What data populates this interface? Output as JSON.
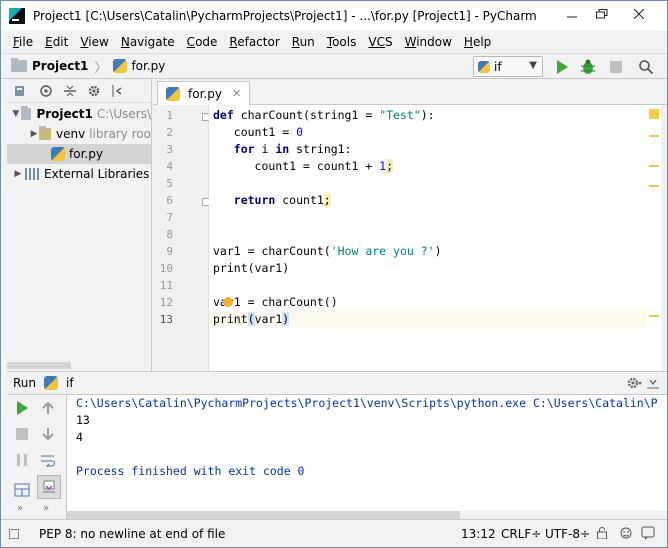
{
  "window": {
    "title": "Project1 [C:\\Users\\Catalin\\PycharmProjects\\Project1] - ...\\for.py [Project1] - PyCharm"
  },
  "menu": [
    {
      "u": "F",
      "rest": "ile"
    },
    {
      "u": "E",
      "rest": "dit"
    },
    {
      "u": "V",
      "rest": "iew"
    },
    {
      "u": "N",
      "rest": "avigate"
    },
    {
      "u": "C",
      "rest": "ode"
    },
    {
      "u": "R",
      "rest": "efactor"
    },
    {
      "u": "R",
      "rest": "un"
    },
    {
      "u": "T",
      "rest": "ools"
    },
    {
      "u": "VC",
      "rest": "S"
    },
    {
      "u": "W",
      "rest": "indow"
    },
    {
      "u": "H",
      "rest": "elp"
    }
  ],
  "breadcrumb": {
    "project": "Project1",
    "file": "for.py"
  },
  "run_config": {
    "selected": "if"
  },
  "project_tree": {
    "root_label": "Project1",
    "root_path": "C:\\Users\\",
    "venv_label": "venv",
    "venv_hint": "library roo",
    "file_label": "for.py",
    "ext_libs_label": "External Libraries"
  },
  "editor": {
    "tab_label": "for.py",
    "line_numbers": [
      "1",
      "2",
      "3",
      "4",
      "5",
      "6",
      "7",
      "8",
      "9",
      "10",
      "11",
      "12",
      "13"
    ],
    "current_line": 13
  },
  "run_panel": {
    "title": "Run",
    "config": "if",
    "output": [
      "C:\\Users\\Catalin\\PycharmProjects\\Project1\\venv\\Scripts\\python.exe C:\\Users\\Catalin\\P",
      "13",
      "4",
      "",
      "Process finished with exit code 0"
    ]
  },
  "status_bar": {
    "message": "PEP 8: no newline at end of file",
    "position": "13:12",
    "line_sep": "CRLF÷",
    "encoding": "UTF-8÷"
  },
  "colors": {
    "keyword": "#000080",
    "string": "#008080",
    "number": "#0000ff",
    "output_path": "#0033b3",
    "run_green": "#3aa93a"
  }
}
